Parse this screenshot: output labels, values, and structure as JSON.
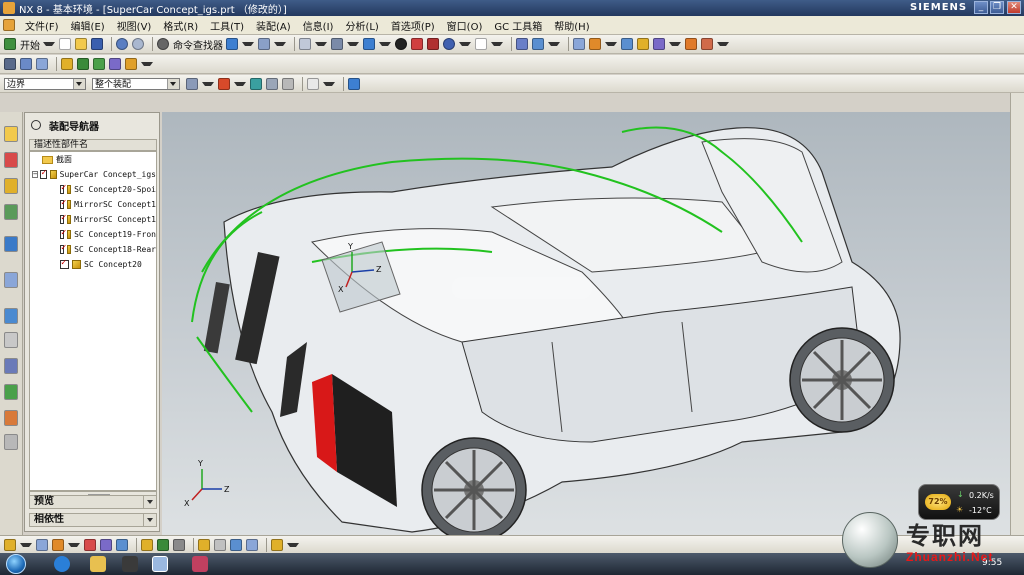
{
  "window": {
    "title": "NX 8 - 基本环境 - [SuperCar Concept_igs.prt （修改的）]",
    "brand": "SIEMENS",
    "controls": {
      "minimize": "_",
      "restore": "❐",
      "close": "✕"
    }
  },
  "menubar": {
    "items": [
      "文件(F)",
      "编辑(E)",
      "视图(V)",
      "格式(R)",
      "工具(T)",
      "装配(A)",
      "信息(I)",
      "分析(L)",
      "首选项(P)",
      "窗口(O)",
      "GC 工具箱",
      "帮助(H)"
    ]
  },
  "toolbar_main": {
    "start_label": "开始",
    "command_finder_label": "命令查找器"
  },
  "selection_bar": {
    "filter_value": "边界",
    "scope_value": "整个装配"
  },
  "navigator": {
    "title": "装配导航器",
    "column_header": "描述性部件名",
    "section_folder": "截面",
    "root": "SuperCar Concept_igs",
    "children": [
      "SC Concept20-Spoi",
      "MirrorSC Concept1",
      "MirrorSC Concept1",
      "SC Concept19-Fron",
      "SC Concept18-Rear",
      "SC Concept20"
    ],
    "panels": {
      "preview": "预览",
      "dependency": "相依性"
    }
  },
  "viewport": {
    "csys_labels": {
      "x": "X",
      "y": "Y",
      "z": "Z"
    },
    "view_triad": {
      "x": "X",
      "y": "Y",
      "z": "Z"
    }
  },
  "taskbar": {
    "clock": "9:55"
  },
  "gadget": {
    "percent": "72%",
    "net_speed": "0.2K/s",
    "temp": "-12°C"
  },
  "watermark": {
    "text": "专职网",
    "url": "Zhuanzhi.Net"
  },
  "colors": {
    "title_bar": "#2c4570",
    "viewport_top": "#aeb7be",
    "car_body": "#e9ecef",
    "curve_green": "#22c21f",
    "tail_light": "#d81818"
  }
}
